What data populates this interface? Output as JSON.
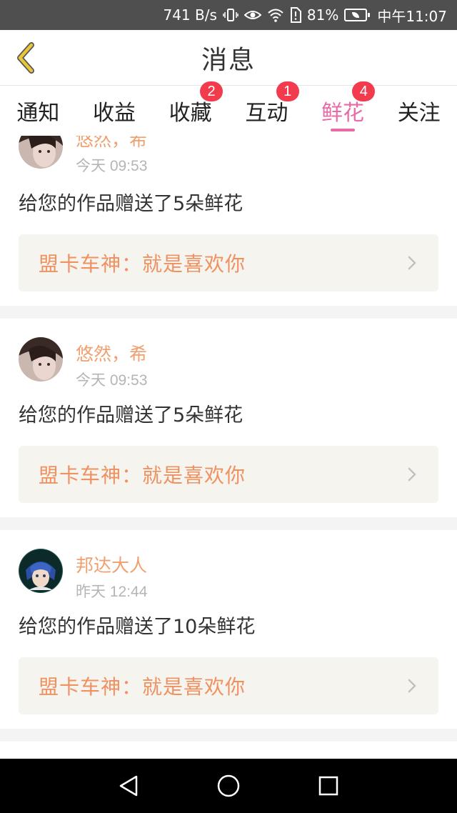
{
  "status_bar": {
    "speed": "741 B/s",
    "battery_percent": "81%",
    "time": "中午11:07",
    "icons": [
      "vibrate-icon",
      "eye-icon",
      "wifi-icon",
      "sim-icon",
      "battery-icon"
    ]
  },
  "header": {
    "title": "消息",
    "back_icon": "chevron-left-icon"
  },
  "tabs": [
    {
      "label": "通知",
      "badge": ""
    },
    {
      "label": "收益",
      "badge": ""
    },
    {
      "label": "收藏",
      "badge": "2"
    },
    {
      "label": "互动",
      "badge": "1"
    },
    {
      "label": "鲜花",
      "badge": "4",
      "active": true
    },
    {
      "label": "关注",
      "badge": ""
    }
  ],
  "feed": [
    {
      "username": "悠然，希",
      "timestamp": "今天 09:53",
      "message": "给您的作品赠送了5朵鲜花",
      "reference": "盟卡车神：就是喜欢你"
    },
    {
      "username": "悠然，希",
      "timestamp": "今天 09:53",
      "message": "给您的作品赠送了5朵鲜花",
      "reference": "盟卡车神：就是喜欢你"
    },
    {
      "username": "邦达大人",
      "timestamp": "昨天 12:44",
      "message": "给您的作品赠送了10朵鲜花",
      "reference": "盟卡车神：就是喜欢你"
    }
  ],
  "colors": {
    "accent_pink": "#e86aa6",
    "badge_red": "#f23c4d",
    "username_orange": "#f0a070",
    "reference_orange": "#ef9160",
    "back_arrow_yellow": "#e8c53a"
  },
  "nav_bar": {
    "icons": [
      "back-triangle-icon",
      "home-circle-icon",
      "recents-square-icon"
    ]
  }
}
